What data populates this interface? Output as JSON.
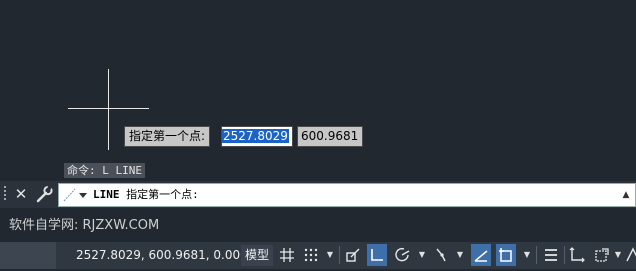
{
  "tooltip": {
    "prompt": "指定第一个点:"
  },
  "dynamic_input": {
    "x_value": "2527.8029",
    "y_value": "600.9681"
  },
  "command_history": {
    "last_line": "命令: L LINE"
  },
  "command_line": {
    "command": "LINE",
    "prompt": "指定第一个点:"
  },
  "watermark": {
    "text": "软件自学网: RJZXW.COM"
  },
  "status_bar": {
    "coordinates": "2527.8029, 600.9681, 0.0000",
    "model_label": "模型"
  },
  "colors": {
    "canvas": "#212830",
    "selection": "#1c63c8",
    "toggle_active": "#3f6fa8"
  }
}
